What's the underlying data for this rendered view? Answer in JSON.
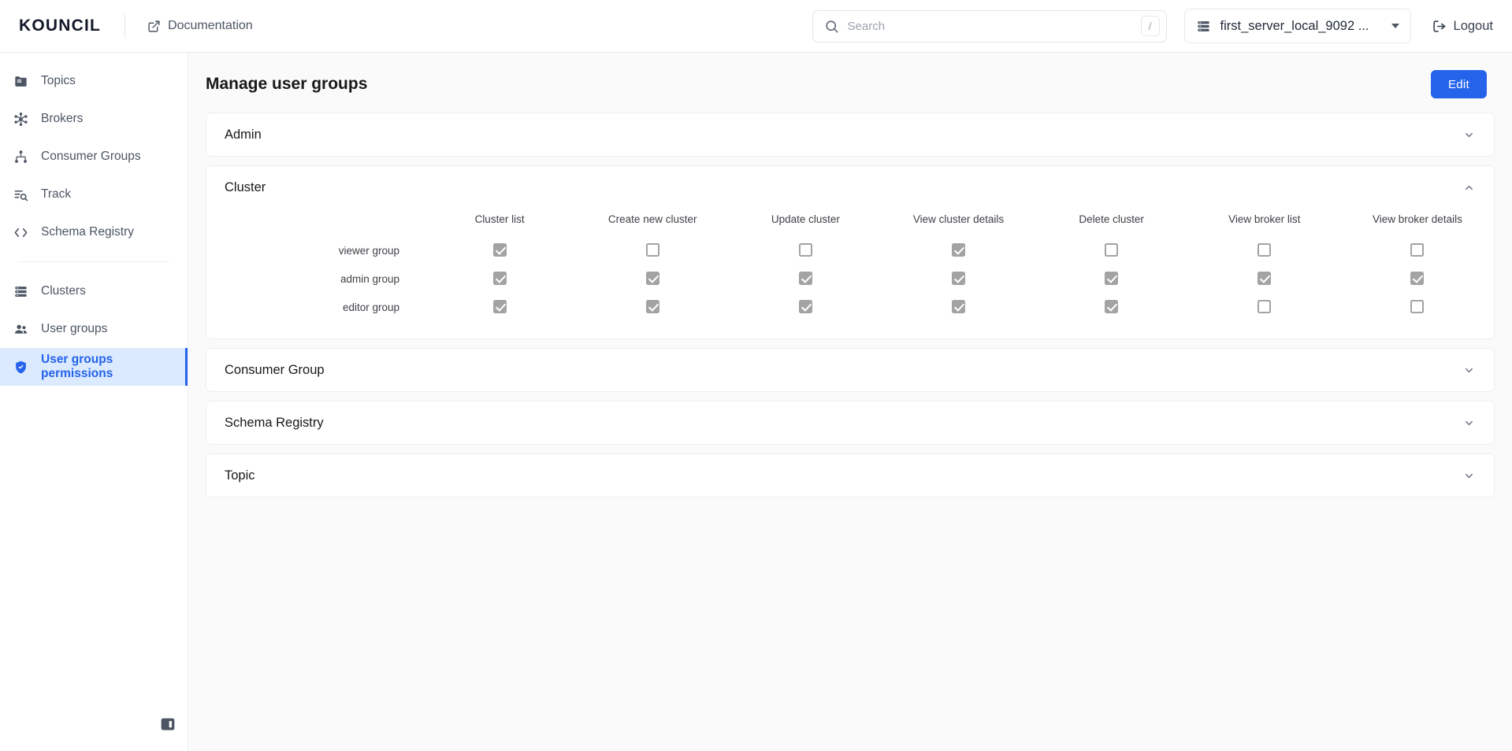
{
  "header": {
    "brand": "KOUNCIL",
    "documentation_label": "Documentation",
    "documentation_icon": "external-link-icon",
    "search": {
      "placeholder": "Search",
      "value": "",
      "icon": "search-icon",
      "shortcut_key": "/"
    },
    "cluster_selector": {
      "value": "first_server_local_9092 ...",
      "icon": "server-icon",
      "caret_icon": "caret-down-icon"
    },
    "logout_label": "Logout",
    "logout_icon": "logout-icon"
  },
  "sidebar": {
    "group1": [
      {
        "label": "Topics",
        "icon": "folder-icon",
        "active": false
      },
      {
        "label": "Brokers",
        "icon": "hub-icon",
        "active": false
      },
      {
        "label": "Consumer Groups",
        "icon": "sitemap-icon",
        "active": false
      },
      {
        "label": "Track",
        "icon": "list-search-icon",
        "active": false
      },
      {
        "label": "Schema Registry",
        "icon": "code-brackets-icon",
        "active": false
      }
    ],
    "group2": [
      {
        "label": "Clusters",
        "icon": "server-list-icon",
        "active": false
      },
      {
        "label": "User groups",
        "icon": "people-icon",
        "active": false
      },
      {
        "label": "User groups permissions",
        "icon": "shield-check-icon",
        "active": true
      }
    ],
    "collapse_icon": "sidebar-toggle-icon"
  },
  "main": {
    "page_title": "Manage user groups",
    "edit_label": "Edit",
    "panels": [
      {
        "title": "Admin",
        "expanded": false,
        "chevron": "chevron-down-icon"
      },
      {
        "title": "Cluster",
        "expanded": true,
        "chevron": "chevron-up-icon"
      },
      {
        "title": "Consumer Group",
        "expanded": false,
        "chevron": "chevron-down-icon"
      },
      {
        "title": "Schema Registry",
        "expanded": false,
        "chevron": "chevron-down-icon"
      },
      {
        "title": "Topic",
        "expanded": false,
        "chevron": "chevron-down-icon"
      }
    ],
    "cluster_table": {
      "row_header_label": "",
      "columns": [
        "Cluster list",
        "Create new cluster",
        "Update cluster",
        "View cluster details",
        "Delete cluster",
        "View broker list",
        "View broker details"
      ],
      "rows": [
        {
          "group": "viewer group",
          "values": [
            true,
            false,
            false,
            true,
            false,
            false,
            false
          ]
        },
        {
          "group": "admin group",
          "values": [
            true,
            true,
            true,
            true,
            true,
            true,
            true
          ]
        },
        {
          "group": "editor group",
          "values": [
            true,
            true,
            true,
            true,
            true,
            false,
            false
          ]
        }
      ]
    }
  },
  "colors": {
    "accent": "#2563eb",
    "active_nav_bg": "#dbeafe",
    "checkbox_gray": "#a3a3a3",
    "page_bg": "#fafafa"
  }
}
